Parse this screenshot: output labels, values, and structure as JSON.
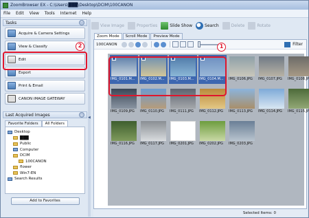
{
  "window": {
    "title": "ZoomBrowser EX  -  C:\\Users\\███\\Desktop\\DCIM\\100CANON"
  },
  "menu": [
    "File",
    "Edit",
    "View",
    "Tools",
    "Internet",
    "Help"
  ],
  "tasks_header": "Tasks",
  "tasks": [
    {
      "label": "Acquire & Camera Settings",
      "kind": "acquire"
    },
    {
      "label": "View & Classify",
      "kind": "view"
    },
    {
      "label": "Edit",
      "kind": "edit"
    },
    {
      "label": "Export",
      "kind": "export"
    },
    {
      "label": "Print & Email",
      "kind": "print"
    },
    {
      "label": "CANON iMAGE GATEWAY",
      "kind": "gateway"
    }
  ],
  "last_acquired_header": "Last Acquired Images",
  "folder_tabs": [
    "Favorite Folders",
    "All Folders"
  ],
  "tree": [
    {
      "label": "Desktop",
      "depth": 0,
      "icon": "desktop"
    },
    {
      "label": "███",
      "depth": 1,
      "icon": "folder"
    },
    {
      "label": "Public",
      "depth": 1,
      "icon": "folder"
    },
    {
      "label": "Computer",
      "depth": 1,
      "icon": "computer"
    },
    {
      "label": "DCIM",
      "depth": 1,
      "icon": "folder"
    },
    {
      "label": "100CANON",
      "depth": 2,
      "icon": "folder"
    },
    {
      "label": "flower",
      "depth": 1,
      "icon": "folder"
    },
    {
      "label": "Win7-EN",
      "depth": 1,
      "icon": "folder"
    },
    {
      "label": "Search Results",
      "depth": 0,
      "icon": "search"
    }
  ],
  "add_to_favorites": "Add to Favorites",
  "toolbar": {
    "view_image": "View Image",
    "properties": "Properties",
    "slide_show": "Slide Show",
    "search": "Search",
    "delete": "Delete",
    "rotate": "Rotate"
  },
  "view_tabs": [
    "Zoom Mode",
    "Scroll Mode",
    "Preview Mode"
  ],
  "nav": {
    "path": "100CANON",
    "filter": "Filter"
  },
  "callouts": {
    "one": "1",
    "two": "2"
  },
  "images": [
    {
      "name": "IMG_0101.JPG",
      "cap": "IMG_0101.M...",
      "selected": true,
      "badge": true,
      "colors": [
        "#5b7ea8",
        "#c9d4de"
      ]
    },
    {
      "name": "IMG_0102.JPG",
      "cap": "IMG_0102.M...",
      "selected": true,
      "badge": true,
      "colors": [
        "#6e8fb0",
        "#d4c79a"
      ]
    },
    {
      "name": "IMG_0103.JPG",
      "cap": "IMG_0103.M...",
      "selected": true,
      "badge": true,
      "colors": [
        "#4f79a8",
        "#8bb7d6"
      ]
    },
    {
      "name": "IMG_0104.JPG",
      "cap": "IMG_0104.M...",
      "selected": true,
      "badge": true,
      "colors": [
        "#6d8fc0",
        "#9ab8d8"
      ]
    },
    {
      "name": "IMG_0106.JPG",
      "cap": "IMG_0106.JPG",
      "selected": false,
      "badge": false,
      "colors": [
        "#8ea0a8",
        "#c9c7bb"
      ]
    },
    {
      "name": "IMG_0107.JPG",
      "cap": "IMG_0107.JPG",
      "selected": false,
      "badge": false,
      "colors": [
        "#6f7a86",
        "#b8b2a5"
      ]
    },
    {
      "name": "IMG_0108.JPG",
      "cap": "IMG_0108.JPG",
      "selected": false,
      "badge": false,
      "colors": [
        "#6c6b68",
        "#a79a86"
      ]
    },
    {
      "name": "IMG_0109.JPG",
      "cap": "IMG_0109.JPG",
      "selected": false,
      "badge": false,
      "colors": [
        "#3a4656",
        "#8a95a2"
      ]
    },
    {
      "name": "IMG_0110.JPG",
      "cap": "IMG_0110.JPG",
      "selected": false,
      "badge": false,
      "colors": [
        "#6d9ccf",
        "#b79c7a"
      ]
    },
    {
      "name": "IMG_0111.JPG",
      "cap": "IMG_0111.JPG",
      "selected": false,
      "badge": false,
      "colors": [
        "#5d6470",
        "#a5a8ab"
      ]
    },
    {
      "name": "IMG_0112.JPG",
      "cap": "IMG_0112.JPG",
      "selected": false,
      "badge": false,
      "colors": [
        "#b98a3c",
        "#e3c785"
      ]
    },
    {
      "name": "IMG_0113.JPG",
      "cap": "IMG_0113.JPG",
      "selected": false,
      "badge": false,
      "colors": [
        "#8bb4dc",
        "#a98f6a"
      ]
    },
    {
      "name": "IMG_0114.JPG",
      "cap": "IMG_0114.JPG",
      "selected": false,
      "badge": false,
      "colors": [
        "#7eaad8",
        "#d8e6f2"
      ]
    },
    {
      "name": "IMG_0115.JPG",
      "cap": "IMG_0115.JPG",
      "selected": false,
      "badge": false,
      "colors": [
        "#4d6b3a",
        "#93a876"
      ]
    },
    {
      "name": "IMG_0116.JPG",
      "cap": "IMG_0116.JPG",
      "selected": false,
      "badge": false,
      "colors": [
        "#3e5f2e",
        "#7f9a5c"
      ]
    },
    {
      "name": "IMG_0117.JPG",
      "cap": "IMG_0117.JPG",
      "selected": false,
      "badge": false,
      "colors": [
        "#8a8f94",
        "#d9dcdf"
      ]
    },
    {
      "name": "IMG_0201.JPG",
      "cap": "IMG_0201.JPG",
      "selected": false,
      "badge": false,
      "colors": [
        "#ffffff",
        "#ffffff"
      ]
    },
    {
      "name": "IMG_0202.JPG",
      "cap": "IMG_0202.JPG",
      "selected": false,
      "badge": false,
      "colors": [
        "#6d9d3e",
        "#c9d8a6"
      ]
    },
    {
      "name": "IMG_0203.JPG",
      "cap": "IMG_0203.JPG",
      "selected": false,
      "badge": false,
      "colors": [
        "#6a7f96",
        "#b9c4cf"
      ]
    }
  ],
  "status": "Selected Items: 0",
  "colors": {
    "accent": "#3d67b0",
    "callout_red": "#e0152c"
  }
}
